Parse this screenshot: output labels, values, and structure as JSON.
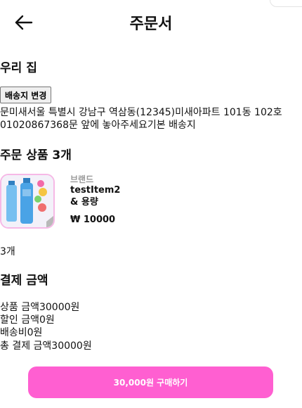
{
  "header": {
    "title": "주문서"
  },
  "address": {
    "name": "우리 집",
    "change_label": "배송지 변경",
    "line1": "문미새서울 특별시 강남구 역삼동(12345)미새아파트 101동 102호",
    "line2": "01020867368문 앞에 놓아주세요기본 배송지"
  },
  "products": {
    "title": "주문 상품 3개",
    "item": {
      "brand": "브랜드",
      "name_line1": "testItem2",
      "name_line2": "& 용량",
      "price": "₩ 10000"
    },
    "quantity": "3개"
  },
  "payment": {
    "title": "결제 금액",
    "product_amount": "상품 금액30000원",
    "discount": "할인 금액0원",
    "shipping": "배송비0원",
    "total": "총 결제 금액30000원"
  },
  "buy_button": "30,000원 구매하기",
  "colors": {
    "accent": "#ff5fd1",
    "thumb_border": "#f6b8e6",
    "brand_gray": "#9a9a9a"
  }
}
